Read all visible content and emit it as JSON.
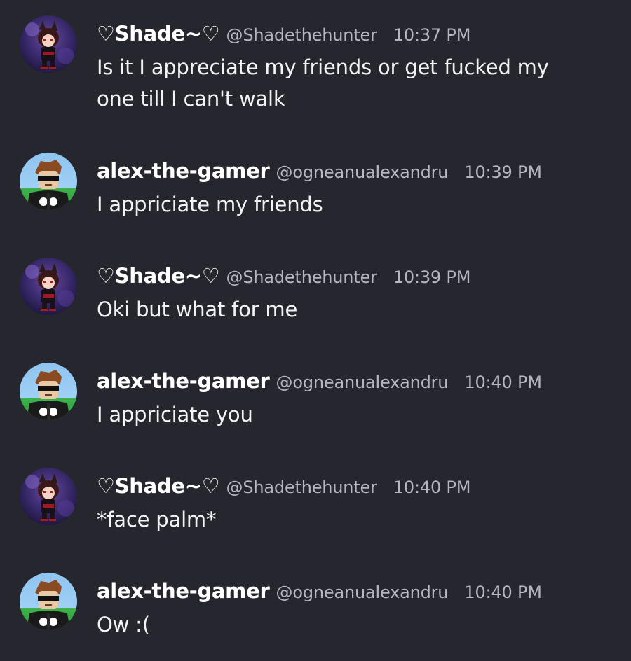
{
  "messages": [
    {
      "username": "♡Shade~♡",
      "handle": "@Shadethehunter",
      "time": "10:37 PM",
      "text": "Is it I appreciate my friends or get fucked my one till I can't walk",
      "avatar_icon": "anime-character-avatar-icon"
    },
    {
      "username": "alex-the-gamer",
      "handle": "@ogneanualexandru",
      "time": "10:39 PM",
      "text": "I appriciate my friends",
      "avatar_icon": "roblox-character-avatar-icon"
    },
    {
      "username": "♡Shade~♡",
      "handle": "@Shadethehunter",
      "time": "10:39 PM",
      "text": "Oki but what for me",
      "avatar_icon": "anime-character-avatar-icon"
    },
    {
      "username": "alex-the-gamer",
      "handle": "@ogneanualexandru",
      "time": "10:40 PM",
      "text": "I appriciate you",
      "avatar_icon": "roblox-character-avatar-icon"
    },
    {
      "username": "♡Shade~♡",
      "handle": "@Shadethehunter",
      "time": "10:40 PM",
      "text": "*face palm*",
      "avatar_icon": "anime-character-avatar-icon"
    },
    {
      "username": "alex-the-gamer",
      "handle": "@ogneanualexandru",
      "time": "10:40 PM",
      "text": "Ow :(",
      "avatar_icon": "roblox-character-avatar-icon"
    }
  ],
  "colors": {
    "background": "#26262f",
    "username": "#ffffff",
    "meta": "#b5b7bf",
    "text": "#f2f3f5"
  }
}
